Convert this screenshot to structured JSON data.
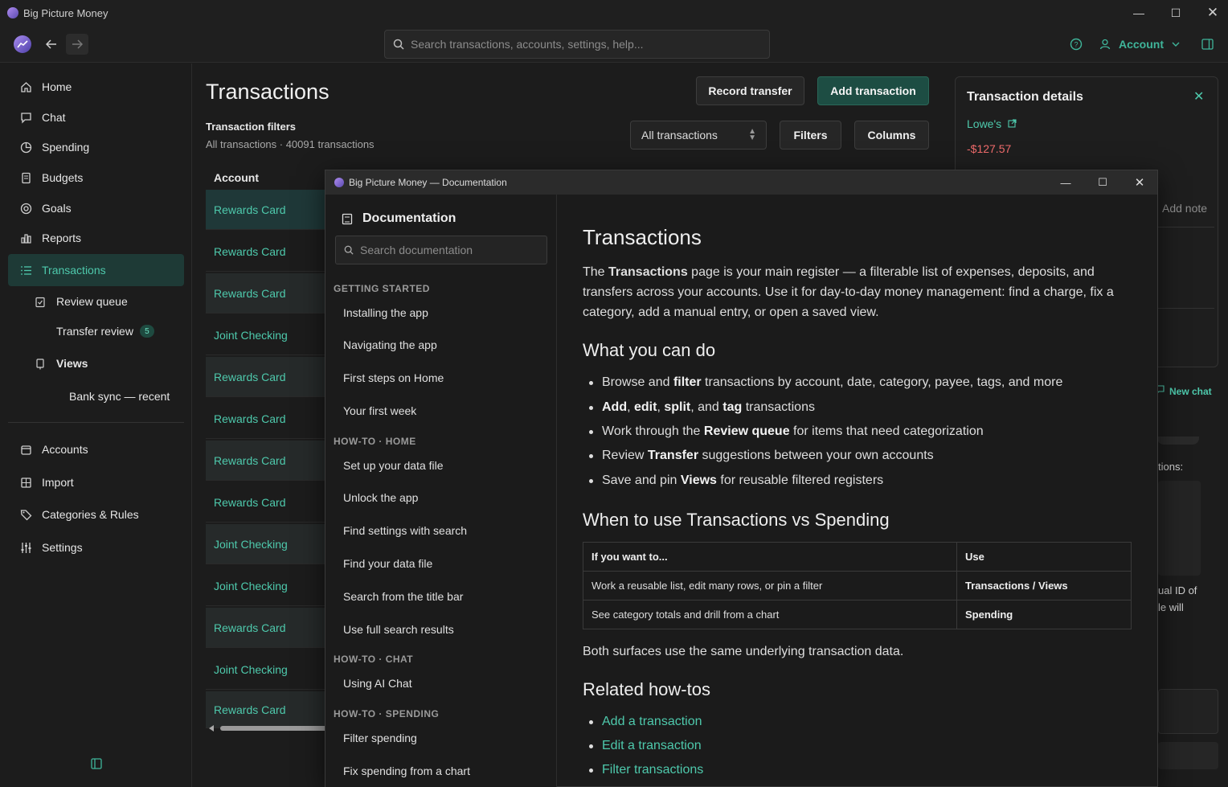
{
  "window": {
    "title": "Big Picture Money"
  },
  "toolbar": {
    "search_placeholder": "Search transactions, accounts, settings, help...",
    "account_label": "Account"
  },
  "sidebar": {
    "items": [
      {
        "label": "Home",
        "icon": "home-icon"
      },
      {
        "label": "Chat",
        "icon": "chat-icon"
      },
      {
        "label": "Spending",
        "icon": "spending-icon"
      },
      {
        "label": "Budgets",
        "icon": "budgets-icon"
      },
      {
        "label": "Goals",
        "icon": "goals-icon"
      },
      {
        "label": "Reports",
        "icon": "reports-icon"
      },
      {
        "label": "Transactions",
        "icon": "list-icon",
        "active": true
      }
    ],
    "sub_items": [
      {
        "label": "Review queue"
      },
      {
        "label": "Transfer review",
        "badge": "5"
      },
      {
        "label": "Views"
      },
      {
        "label": "Bank sync — recent"
      }
    ],
    "bottom_items": [
      {
        "label": "Accounts"
      },
      {
        "label": "Import"
      },
      {
        "label": "Categories & Rules"
      },
      {
        "label": "Settings"
      }
    ]
  },
  "main": {
    "title": "Transactions",
    "record_transfer": "Record transfer",
    "add_transaction": "Add transaction",
    "filters_title": "Transaction filters",
    "filters_sub": "All transactions · 40091 transactions",
    "select_value": "All transactions",
    "filters_btn": "Filters",
    "columns_btn": "Columns",
    "column_account": "Account",
    "rows": [
      "Rewards Card",
      "Rewards Card",
      "Rewards Card",
      "Joint Checking",
      "Rewards Card",
      "Rewards Card",
      "Rewards Card",
      "Rewards Card",
      "Joint Checking",
      "Joint Checking",
      "Rewards Card",
      "Joint Checking",
      "Rewards Card"
    ]
  },
  "details": {
    "title": "Transaction details",
    "payee": "Lowe's",
    "amount": "-$127.57",
    "add_note": "Add note",
    "new_chat": "New chat",
    "partial_1": "tions:",
    "partial_2": "ual ID of",
    "partial_3": "le will"
  },
  "doc_window": {
    "title": "Big Picture Money — Documentation",
    "nav_title": "Documentation",
    "search_placeholder": "Search documentation",
    "sections": [
      {
        "title": "GETTING STARTED",
        "links": [
          "Installing the app",
          "Navigating the app",
          "First steps on Home",
          "Your first week"
        ]
      },
      {
        "title": "HOW-TO · HOME",
        "links": [
          "Set up your data file",
          "Unlock the app",
          "Find settings with search",
          "Find your data file",
          "Search from the title bar",
          "Use full search results"
        ]
      },
      {
        "title": "HOW-TO · CHAT",
        "links": [
          "Using AI Chat"
        ]
      },
      {
        "title": "HOW-TO · SPENDING",
        "links": [
          "Filter spending",
          "Fix spending from a chart"
        ]
      }
    ],
    "content": {
      "h1": "Transactions",
      "intro_a": "The ",
      "intro_b": "Transactions",
      "intro_c": " page is your main register — a filterable list of expenses, deposits, and transfers across your accounts. Use it for day-to-day money management: find a charge, fix a category, add a manual entry, or open a saved view.",
      "h2_what": "What you can do",
      "h2_when": "When to use Transactions vs Spending",
      "table": {
        "header": [
          "If you want to...",
          "Use"
        ],
        "rows": [
          [
            "Work a reusable list, edit many rows, or pin a filter",
            "Transactions / Views"
          ],
          [
            "See category totals and drill from a chart",
            "Spending"
          ]
        ]
      },
      "both_surfaces": "Both surfaces use the same underlying transaction data.",
      "h2_related": "Related how-tos",
      "related": [
        "Add a transaction",
        "Edit a transaction",
        "Filter transactions"
      ]
    }
  }
}
